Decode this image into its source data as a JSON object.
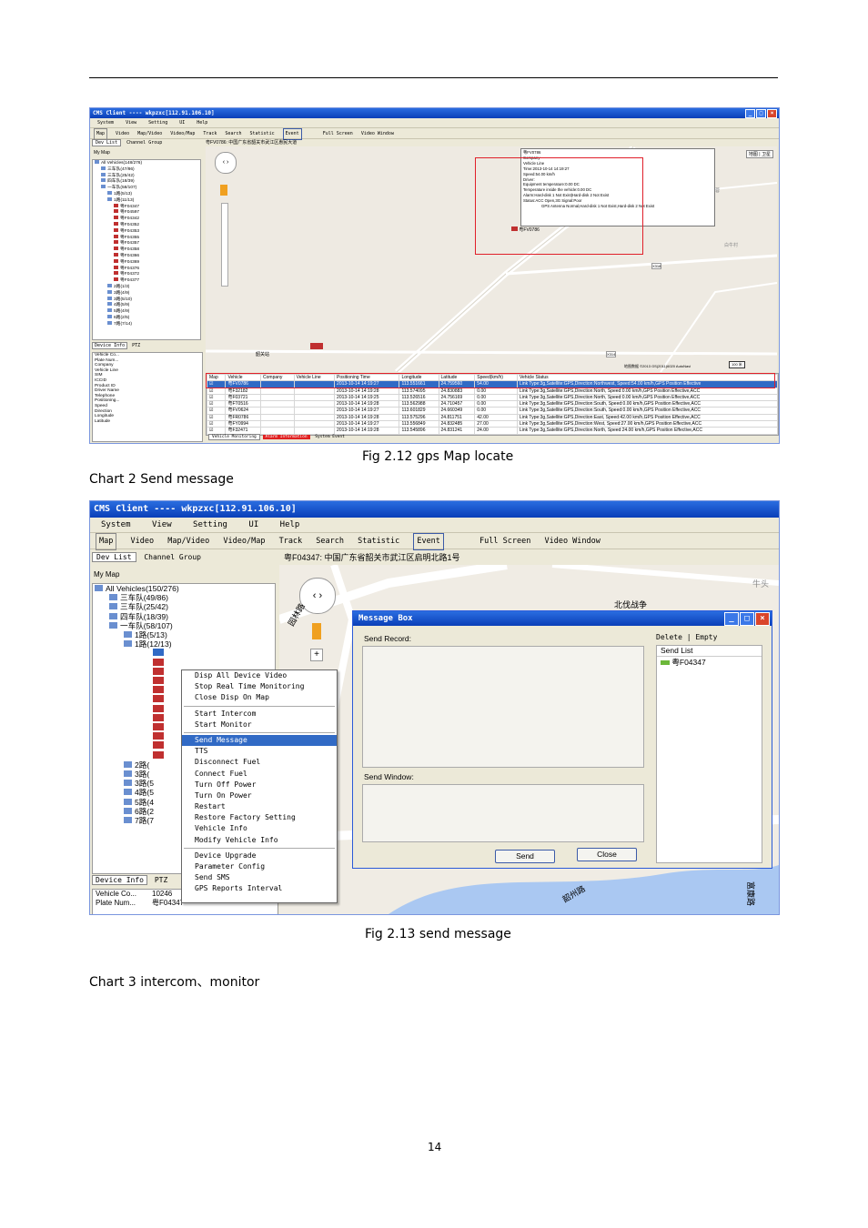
{
  "fig1": {
    "window_title": "CMS Client ---- wkpzxc[112.91.106.10]",
    "menu": [
      "System",
      "View",
      "Setting",
      "UI",
      "Help"
    ],
    "toolbar": [
      "Map",
      "Video",
      "Map/Video",
      "Video/Map",
      "Track",
      "Search",
      "Statistic",
      "Event",
      "Full Screen",
      "Video Window"
    ],
    "tabs": [
      "Dev List",
      "Channel Group"
    ],
    "my_map": "My Map",
    "tree": [
      "All Vehicles(148/276)",
      "三车队(47/86)",
      "三车队(25/42)",
      "四车队(18/39)",
      "一车队(58/107)",
      "1路(5/13)",
      "1路(11/13)",
      "粤F04347",
      "粤F04597",
      "粤F04342",
      "粤F04352",
      "粤F04353",
      "粤F04355",
      "粤F04357",
      "粤F04358",
      "粤F04366",
      "粤F04369",
      "粤F04376",
      "粤F04372",
      "粤F04377",
      "2路(1/3)",
      "3路(4/9)",
      "3路(5/10)",
      "4路(5/9)",
      "5路(4/9)",
      "6路(2/5)",
      "7路(7/14)"
    ],
    "info_tabs": [
      "Device Info",
      "PTZ"
    ],
    "info_fields": [
      "Vehicle Co...",
      "Plate Num...",
      "Company",
      "Vehicle Line",
      "SIM",
      "ICCID",
      "Product ID",
      "Driver Name",
      "Telephone",
      "Positioning...",
      "Speed",
      "Direction",
      "Longitude",
      "Latitude"
    ],
    "address": "粤FV0786: 中国广东省韶关市武江区惠民大道",
    "map_type": [
      "地图",
      "卫星"
    ],
    "map_labels": [
      "韶关站",
      "芙蓉",
      "白牛村",
      "X318",
      "X314"
    ],
    "vehicle_label": "粤FV0786",
    "popup_lines": [
      "粤FV0786",
      "Company",
      "Vehicle Line",
      "Time:2013-10-14 14:19:27",
      "Speed:54.00 km/h",
      "Driver:",
      "Equipment temperature:0.00 DC",
      "Temperature inside the vehicle:0.00 DC",
      "Alarm:Hard-disk 1 Not Exist|Hard-disk 2 Not Exist",
      "Status:ACC Open,3G Signal:Poor",
      "GPS Antenna Normal,Hard-disk 1 Not Exist,Hard-disk 2 Not Exist"
    ],
    "map_footer": "地图数据 ©2013 GS(2011)6020 AutoNavi",
    "scale": "100 米",
    "grid_headers": [
      "Map",
      "Vehicle",
      "Company",
      "Vehicle Line",
      "Positioning Time",
      "Longitude",
      "Latitude",
      "Speed(km/h)",
      "Vehicle Status"
    ],
    "grid_rows": [
      [
        "粤FV0786",
        "",
        "",
        "2013-10-14 14:19:27",
        "113.551661",
        "24.759560",
        "54.00",
        "Link Type:3g,Satellite:GPS,Direction:Northwest, Speed:54.00 km/h,GPS Position Effective"
      ],
      [
        "粤F32182",
        "",
        "",
        "2013-10-14 14:19:28",
        "113.574095",
        "24.830883",
        "0.00",
        "Link Type:3g,Satellite:GPS,Direction:North, Speed:0.00 km/h,GPS Position Effective,ACC"
      ],
      [
        "粤F03721",
        "",
        "",
        "2013-10-14 14:19:25",
        "113.526516",
        "24.756169",
        "0.00",
        "Link Type:3g,Satellite:GPS,Direction:North, Speed:0.00 km/h,GPS Position Effective,ACC"
      ],
      [
        "粤FT0516",
        "",
        "",
        "2013-10-14 14:19:28",
        "113.562988",
        "24.710457",
        "0.00",
        "Link Type:3g,Satellite:GPS,Direction:South, Speed:0.00 km/h,GPS Position Effective,ACC"
      ],
      [
        "粤FV0624",
        "",
        "",
        "2013-10-14 14:19:27",
        "113.601829",
        "24.660349",
        "0.00",
        "Link Type:3g,Satellite:GPS,Direction:South, Speed:0.00 km/h,GPS Position Effective,ACC"
      ],
      [
        "粤FR0786",
        "",
        "",
        "2013-10-14 14:19:28",
        "113.575296",
        "24.811751",
        "42.00",
        "Link Type:3g,Satellite:GPS,Direction:East, Speed:42.00 km/h,GPS Position Effective,ACC"
      ],
      [
        "粤FY0994",
        "",
        "",
        "2013-10-14 14:19:27",
        "113.556849",
        "24.832485",
        "27.00",
        "Link Type:3g,Satellite:GPS,Direction:West, Speed:27.00 km/h,GPS Position Effective,ACC"
      ],
      [
        "粤F32471",
        "",
        "",
        "2013-10-14 14:19:28",
        "113.545896",
        "24.831241",
        "24.00",
        "Link Type:3g,Satellite:GPS,Direction:North, Speed:24.00 km/h,GPS Position Effective,ACC"
      ]
    ],
    "bottom_tabs": [
      "Vehicle Monitoring",
      "Alarm Information",
      "System Event"
    ]
  },
  "caption1": "Fig 2.12 gps Map locate",
  "heading2": "Chart 2 Send message",
  "fig2": {
    "window_title": "CMS Client ---- wkpzxc[112.91.106.10]",
    "menu": [
      "System",
      "View",
      "Setting",
      "UI",
      "Help"
    ],
    "toolbar": [
      "Map",
      "Video",
      "Map/Video",
      "Video/Map",
      "Track",
      "Search",
      "Statistic",
      "Event",
      "Full Screen",
      "Video Window"
    ],
    "tabs": [
      "Dev List",
      "Channel Group"
    ],
    "my_map": "My Map",
    "tree": [
      "All Vehicles(150/276)",
      "三车队(49/86)",
      "三车队(25/42)",
      "四车队(18/39)",
      "一车队(58/107)",
      "1路(5/13)",
      "1路(12/13)"
    ],
    "lower_tree": [
      "2路(",
      "3路(",
      "3路(5",
      "4路(5",
      "5路(4",
      "6路(2",
      "7路(7"
    ],
    "context_menu": [
      "Disp All Device Video",
      "Stop Real Time Monitoring",
      "Close Disp On Map",
      "Start Intercom",
      "Start Monitor",
      "Send Message",
      "TTS",
      "Disconnect Fuel",
      "Connect Fuel",
      "Turn Off Power",
      "Turn On Power",
      "Restart",
      "Restore Factory Setting",
      "Vehicle Info",
      "Modify Vehicle Info",
      "Device Upgrade",
      "Parameter Config",
      "Send SMS",
      "GPS Reports Interval"
    ],
    "info_tabs": [
      "Device Info",
      "PTZ"
    ],
    "info_rows": [
      [
        "Vehicle Co...",
        "10246"
      ],
      [
        "Plate Num...",
        "粤F04347"
      ]
    ],
    "address": "粤F04347: 中国广东省韶关市武江区启明北路1号",
    "map_labels": [
      "北伐战争",
      "牛头",
      "园林路",
      "韶州路",
      "富康路"
    ],
    "msgbox": {
      "title": "Message Box",
      "send_record": "Send Record:",
      "send_window": "Send Window:",
      "delete": "Delete",
      "empty": "Empty",
      "send_list": "Send List",
      "list_item": "粤F04347",
      "send_btn": "Send",
      "close_btn": "Close"
    }
  },
  "caption2": "Fig 2.13 send message",
  "heading3": "Chart 3 intercom、monitor",
  "page_number": "14"
}
